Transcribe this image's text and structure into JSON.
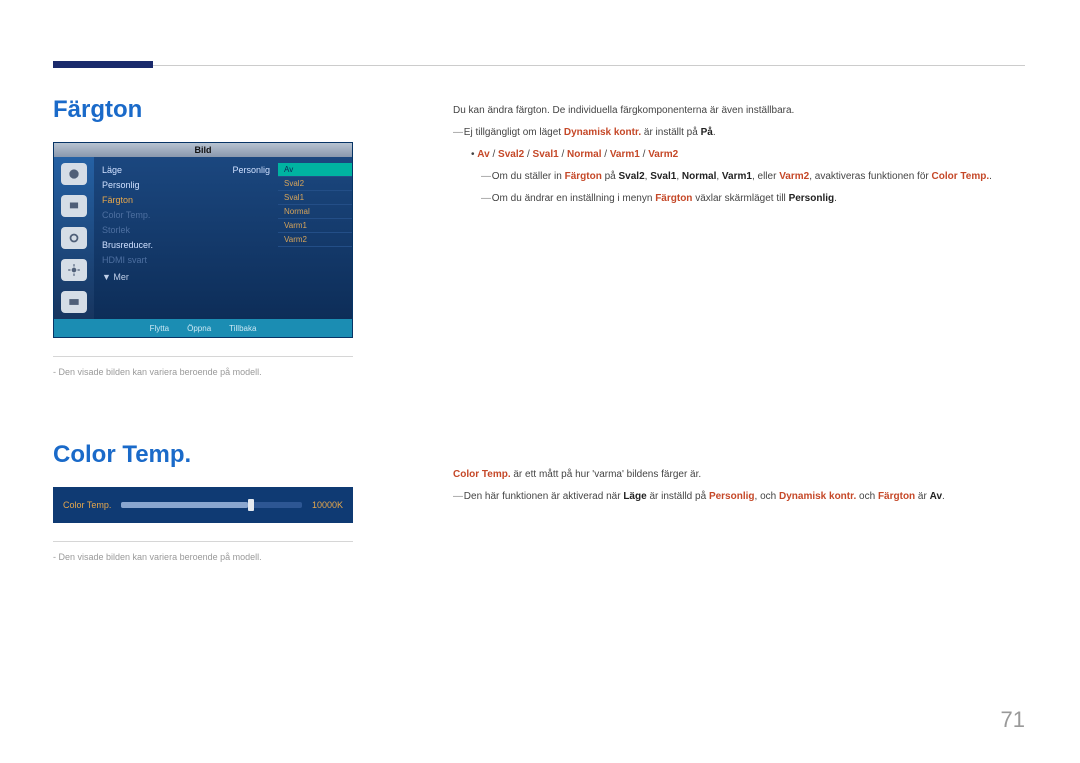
{
  "page_number": "71",
  "fargton": {
    "title": "Färgton",
    "menu_title": "Bild",
    "menu": {
      "rows": [
        {
          "label": "Läge",
          "value": "Personlig",
          "cls": ""
        },
        {
          "label": "Personlig",
          "value": "",
          "cls": ""
        },
        {
          "label": "Färgton",
          "value": "",
          "cls": "highlight"
        },
        {
          "label": "Color Temp.",
          "value": "",
          "cls": "dim"
        },
        {
          "label": "Storlek",
          "value": "",
          "cls": "dim"
        },
        {
          "label": "Brusreducer.",
          "value": "",
          "cls": ""
        },
        {
          "label": "HDMI svart",
          "value": "",
          "cls": "dim"
        }
      ],
      "more": "▼ Mer",
      "options": [
        "Av",
        "Sval2",
        "Sval1",
        "Normal",
        "Varm1",
        "Varm2"
      ],
      "footer": {
        "move": "Flytta",
        "open": "Öppna",
        "back": "Tillbaka"
      }
    },
    "caption": "Den visade bilden kan variera beroende på modell.",
    "body": {
      "intro": "Du kan ändra färgton. De individuella färgkomponenterna är även inställbara.",
      "note1_pre": "Ej tillgängligt om läget ",
      "note1_mid": "Dynamisk kontr.",
      "note1_post": " är inställt på ",
      "note1_end": "På",
      "options_line": {
        "av": "Av",
        "s2": "Sval2",
        "s1": "Sval1",
        "nor": "Normal",
        "v1": "Varm1",
        "v2": "Varm2"
      },
      "note2_a": "Om du ställer in ",
      "note2_fargton": "Färgton",
      "note2_b": " på ",
      "note2_s2": "Sval2",
      "note2_s1": "Sval1",
      "note2_nor": "Normal",
      "note2_v1": "Varm1",
      "note2_or": ", eller ",
      "note2_v2": "Varm2",
      "note2_c": ", avaktiveras funktionen för ",
      "note2_ct": "Color Temp.",
      "note3_a": "Om du ändrar en inställning i menyn ",
      "note3_fargton": "Färgton",
      "note3_b": " växlar skärmläget till ",
      "note3_personlig": "Personlig"
    }
  },
  "colortemp": {
    "title": "Color Temp.",
    "slider_label": "Color Temp.",
    "slider_value": "10000K",
    "caption": "Den visade bilden kan variera beroende på modell.",
    "body": {
      "line1_a": "Color Temp.",
      "line1_b": " är ett mått på hur 'varma' bildens färger är.",
      "line2_a": "Den här funktionen är aktiverad när ",
      "line2_lage": "Läge",
      "line2_b": " är inställd på ",
      "line2_personlig": "Personlig",
      "line2_c": ", och ",
      "line2_dk": "Dynamisk kontr.",
      "line2_d": " och ",
      "line2_fargton": "Färgton",
      "line2_e": " är ",
      "line2_av": "Av"
    }
  }
}
